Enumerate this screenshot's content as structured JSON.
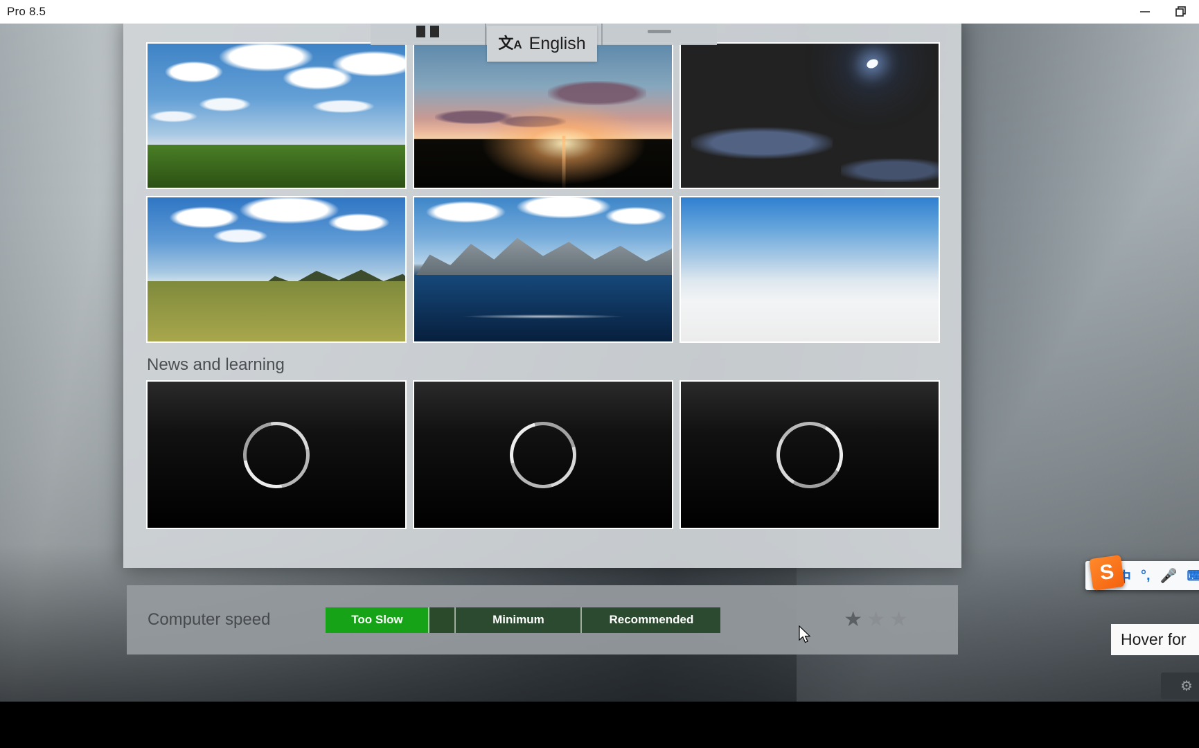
{
  "window": {
    "title": "Pro 8.5",
    "controls": [
      {
        "name": "minimize-button",
        "glyph": "—"
      },
      {
        "name": "restore-button",
        "glyph": "❐"
      }
    ]
  },
  "toolbar": {
    "pause_icon": "pause-icon",
    "grid_icon": "grid-menu-icon",
    "minimize_icon": "collapse-icon"
  },
  "language_chip": {
    "icon": "translate-icon",
    "icon_main": "文",
    "icon_sub": "A",
    "label": "English"
  },
  "thumbnails": [
    {
      "name": "thumbnail-day-field",
      "scene": "sc-day",
      "alt": "Daytime blue sky over green grass field"
    },
    {
      "name": "thumbnail-sunset",
      "scene": "sc-sunset",
      "alt": "Sunset over dark horizon"
    },
    {
      "name": "thumbnail-night",
      "scene": "sc-night",
      "alt": "Night sky with moon"
    },
    {
      "name": "thumbnail-hills",
      "scene": "sc-hills",
      "alt": "Golden field with distant hills"
    },
    {
      "name": "thumbnail-mountain-lake",
      "scene": "sc-water",
      "alt": "Mountains beside blue water"
    },
    {
      "name": "thumbnail-plain-sky",
      "scene": "sc-plain",
      "alt": "Plain gradient sky"
    }
  ],
  "news": {
    "section_title": "News and learning",
    "cards": [
      {
        "name": "news-card-1",
        "state": "loading"
      },
      {
        "name": "news-card-2",
        "state": "loading"
      },
      {
        "name": "news-card-3",
        "state": "loading"
      }
    ]
  },
  "status": {
    "label": "Computer speed",
    "segments": [
      {
        "label": "Too Slow",
        "class": "s1",
        "active": true
      },
      {
        "label": "",
        "class": "s1b",
        "active": false
      },
      {
        "label": "Minimum",
        "class": "s2",
        "active": false
      },
      {
        "label": "Recommended",
        "class": "s3",
        "active": false
      }
    ],
    "stars": [
      {
        "glyph": "★",
        "filled": true
      },
      {
        "glyph": "★",
        "filled": false
      },
      {
        "glyph": "★",
        "filled": false
      }
    ]
  },
  "overlays": {
    "ime": {
      "logo": "S",
      "items": [
        {
          "name": "ime-mode-chinese",
          "glyph": "中"
        },
        {
          "name": "ime-punctuation",
          "glyph": "°,"
        },
        {
          "name": "ime-voice",
          "glyph": "🎤"
        },
        {
          "name": "ime-keyboard",
          "glyph": "⌨"
        }
      ]
    },
    "hover_tooltip": "Hover for",
    "corner_button_icon": "⚙"
  },
  "colors": {
    "accent_green": "#17a317",
    "segment_dark": "#2c4a2f",
    "panel_bg": "#d0d4d7",
    "status_bg": "#969b9f",
    "ime_orange": "#f4610d"
  }
}
